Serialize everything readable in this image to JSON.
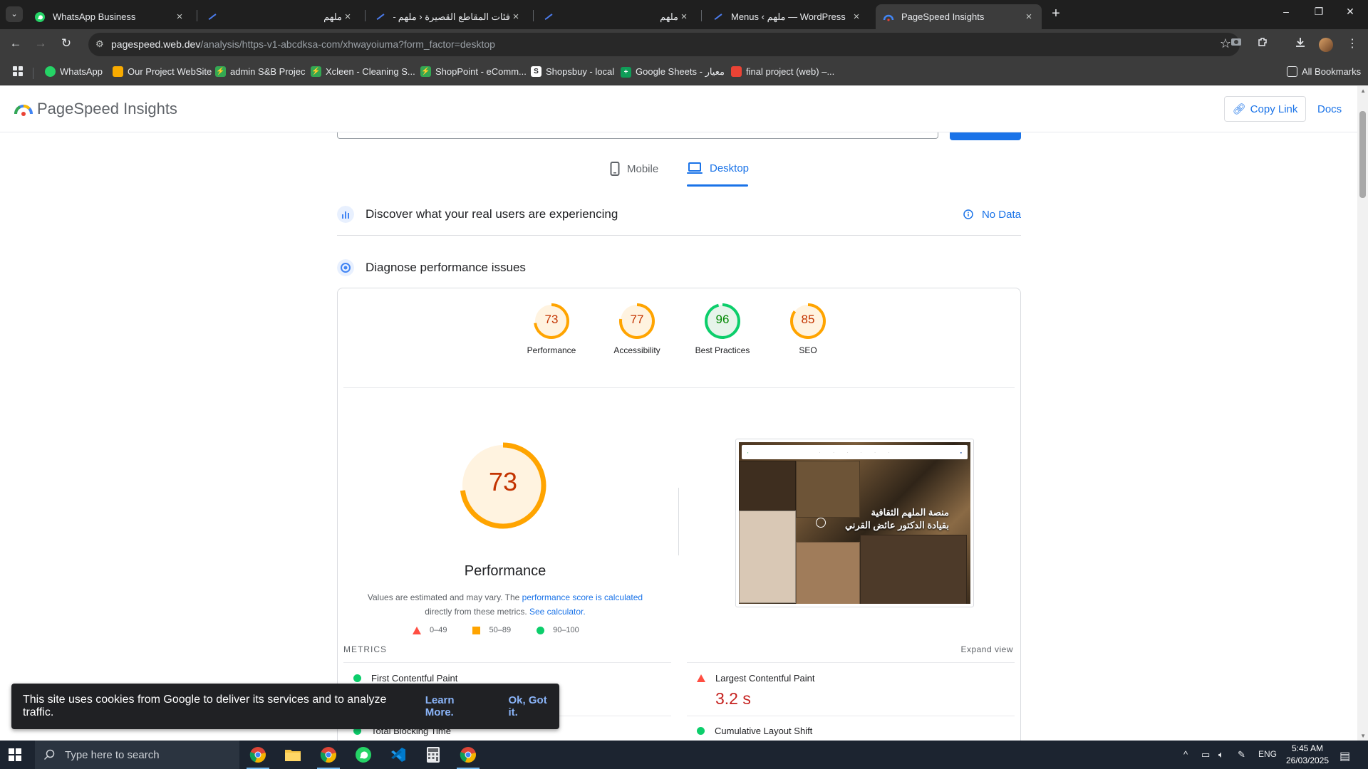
{
  "browser": {
    "tabs": [
      {
        "title": "WhatsApp Business",
        "rtl": false,
        "active": false,
        "favicon": "whatsapp-icon"
      },
      {
        "title": "ملهم",
        "rtl": true,
        "active": false,
        "favicon": "site-icon"
      },
      {
        "title": "فئات المقاطع القصيرة ‹ ملهم —",
        "rtl": true,
        "active": false,
        "favicon": "site-icon"
      },
      {
        "title": "ملهم",
        "rtl": true,
        "active": false,
        "favicon": "site-icon"
      },
      {
        "title": "Menus ‹ ملهم — WordPress",
        "rtl": false,
        "active": false,
        "favicon": "site-icon"
      },
      {
        "title": "PageSpeed Insights",
        "rtl": false,
        "active": true,
        "favicon": "pagespeed-icon"
      }
    ],
    "url_host": "pagespeed.web.dev",
    "url_path": "/analysis/https-v1-abcdksa-com/xhwayoiuma?form_factor=desktop",
    "bookmarks": [
      {
        "label": "WhatsApp",
        "color": "#25d366"
      },
      {
        "label": "Our Project WebSite",
        "color": "#f9ab00"
      },
      {
        "label": "admin S&B Projec",
        "color": "#34a853"
      },
      {
        "label": "Xcleen - Cleaning S...",
        "color": "#34a853"
      },
      {
        "label": "ShopPoint - eComm...",
        "color": "#34a853"
      },
      {
        "label": "Shopsbuy - local",
        "color": "#ffffff"
      },
      {
        "label": "Google Sheets - معيار",
        "color": "#0f9d58"
      },
      {
        "label": "final project (web) –...",
        "color": "#ea4335"
      }
    ],
    "all_bookmarks": "All Bookmarks"
  },
  "header": {
    "title": "PageSpeed Insights",
    "copy_link": "Copy Link",
    "docs": "Docs"
  },
  "device_tabs": {
    "mobile": "Mobile",
    "desktop": "Desktop"
  },
  "sections": {
    "real_users": "Discover what your real users are experiencing",
    "no_data": "No Data",
    "diagnose": "Diagnose performance issues"
  },
  "scores": [
    {
      "label": "Performance",
      "value": 73,
      "color": "#ffa400",
      "bg": "#fff3e0"
    },
    {
      "label": "Accessibility",
      "value": 77,
      "color": "#ffa400",
      "bg": "#fff3e0"
    },
    {
      "label": "Best Practices",
      "value": 96,
      "color": "#0cce6b",
      "bg": "#e6f4ea"
    },
    {
      "label": "SEO",
      "value": 85,
      "color": "#ffa400",
      "bg": "#fff3e0"
    }
  ],
  "performance": {
    "score": 73,
    "title": "Performance",
    "note_before": "Values are estimated and may vary. The ",
    "note_link1": "performance score is calculated",
    "note_middle": "directly from these metrics. ",
    "note_link2": "See calculator.",
    "legend": [
      "0–49",
      "50–89",
      "90–100"
    ]
  },
  "screenshot": {
    "headline_1": "منصة الملهم الثقافية",
    "headline_2": "بقيادة الدكتور عائض القرني"
  },
  "metrics": {
    "label": "METRICS",
    "expand": "Expand view",
    "fcp": "First Contentful Paint",
    "lcp": "Largest Contentful Paint",
    "lcp_value": "3.2 s",
    "tbt": "Total Blocking Time",
    "cls": "Cumulative Layout Shift"
  },
  "cookie": {
    "text": "This site uses cookies from Google to deliver its services and to analyze traffic.",
    "learn_more": "Learn More.",
    "ok": "Ok, Got it."
  },
  "taskbar": {
    "search_placeholder": "Type here to search",
    "lang": "ENG",
    "time": "5:45 AM",
    "date": "26/03/2025"
  }
}
